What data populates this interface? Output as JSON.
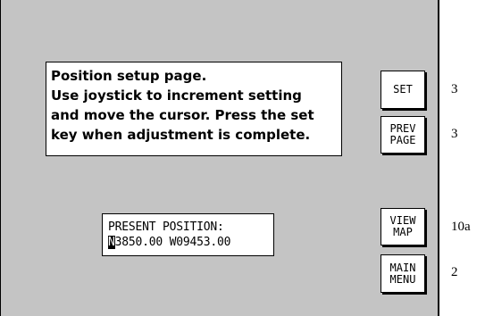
{
  "message": {
    "lines": [
      "Position setup page.",
      "Use joystick to increment setting",
      "and move the cursor. Press the set",
      "key when adjustment is complete."
    ]
  },
  "position": {
    "label": "PRESENT POSITION:",
    "cursor_char": "N",
    "value_rest": "3850.00 W09453.00"
  },
  "buttons": {
    "set": {
      "lines": [
        "SET"
      ],
      "callout": "3"
    },
    "prev_page": {
      "lines": [
        "PREV",
        "PAGE"
      ],
      "callout": "3"
    },
    "view_map": {
      "lines": [
        "VIEW",
        "MAP"
      ],
      "callout": "10a"
    },
    "main_menu": {
      "lines": [
        "MAIN",
        "MENU"
      ],
      "callout": "2"
    }
  }
}
